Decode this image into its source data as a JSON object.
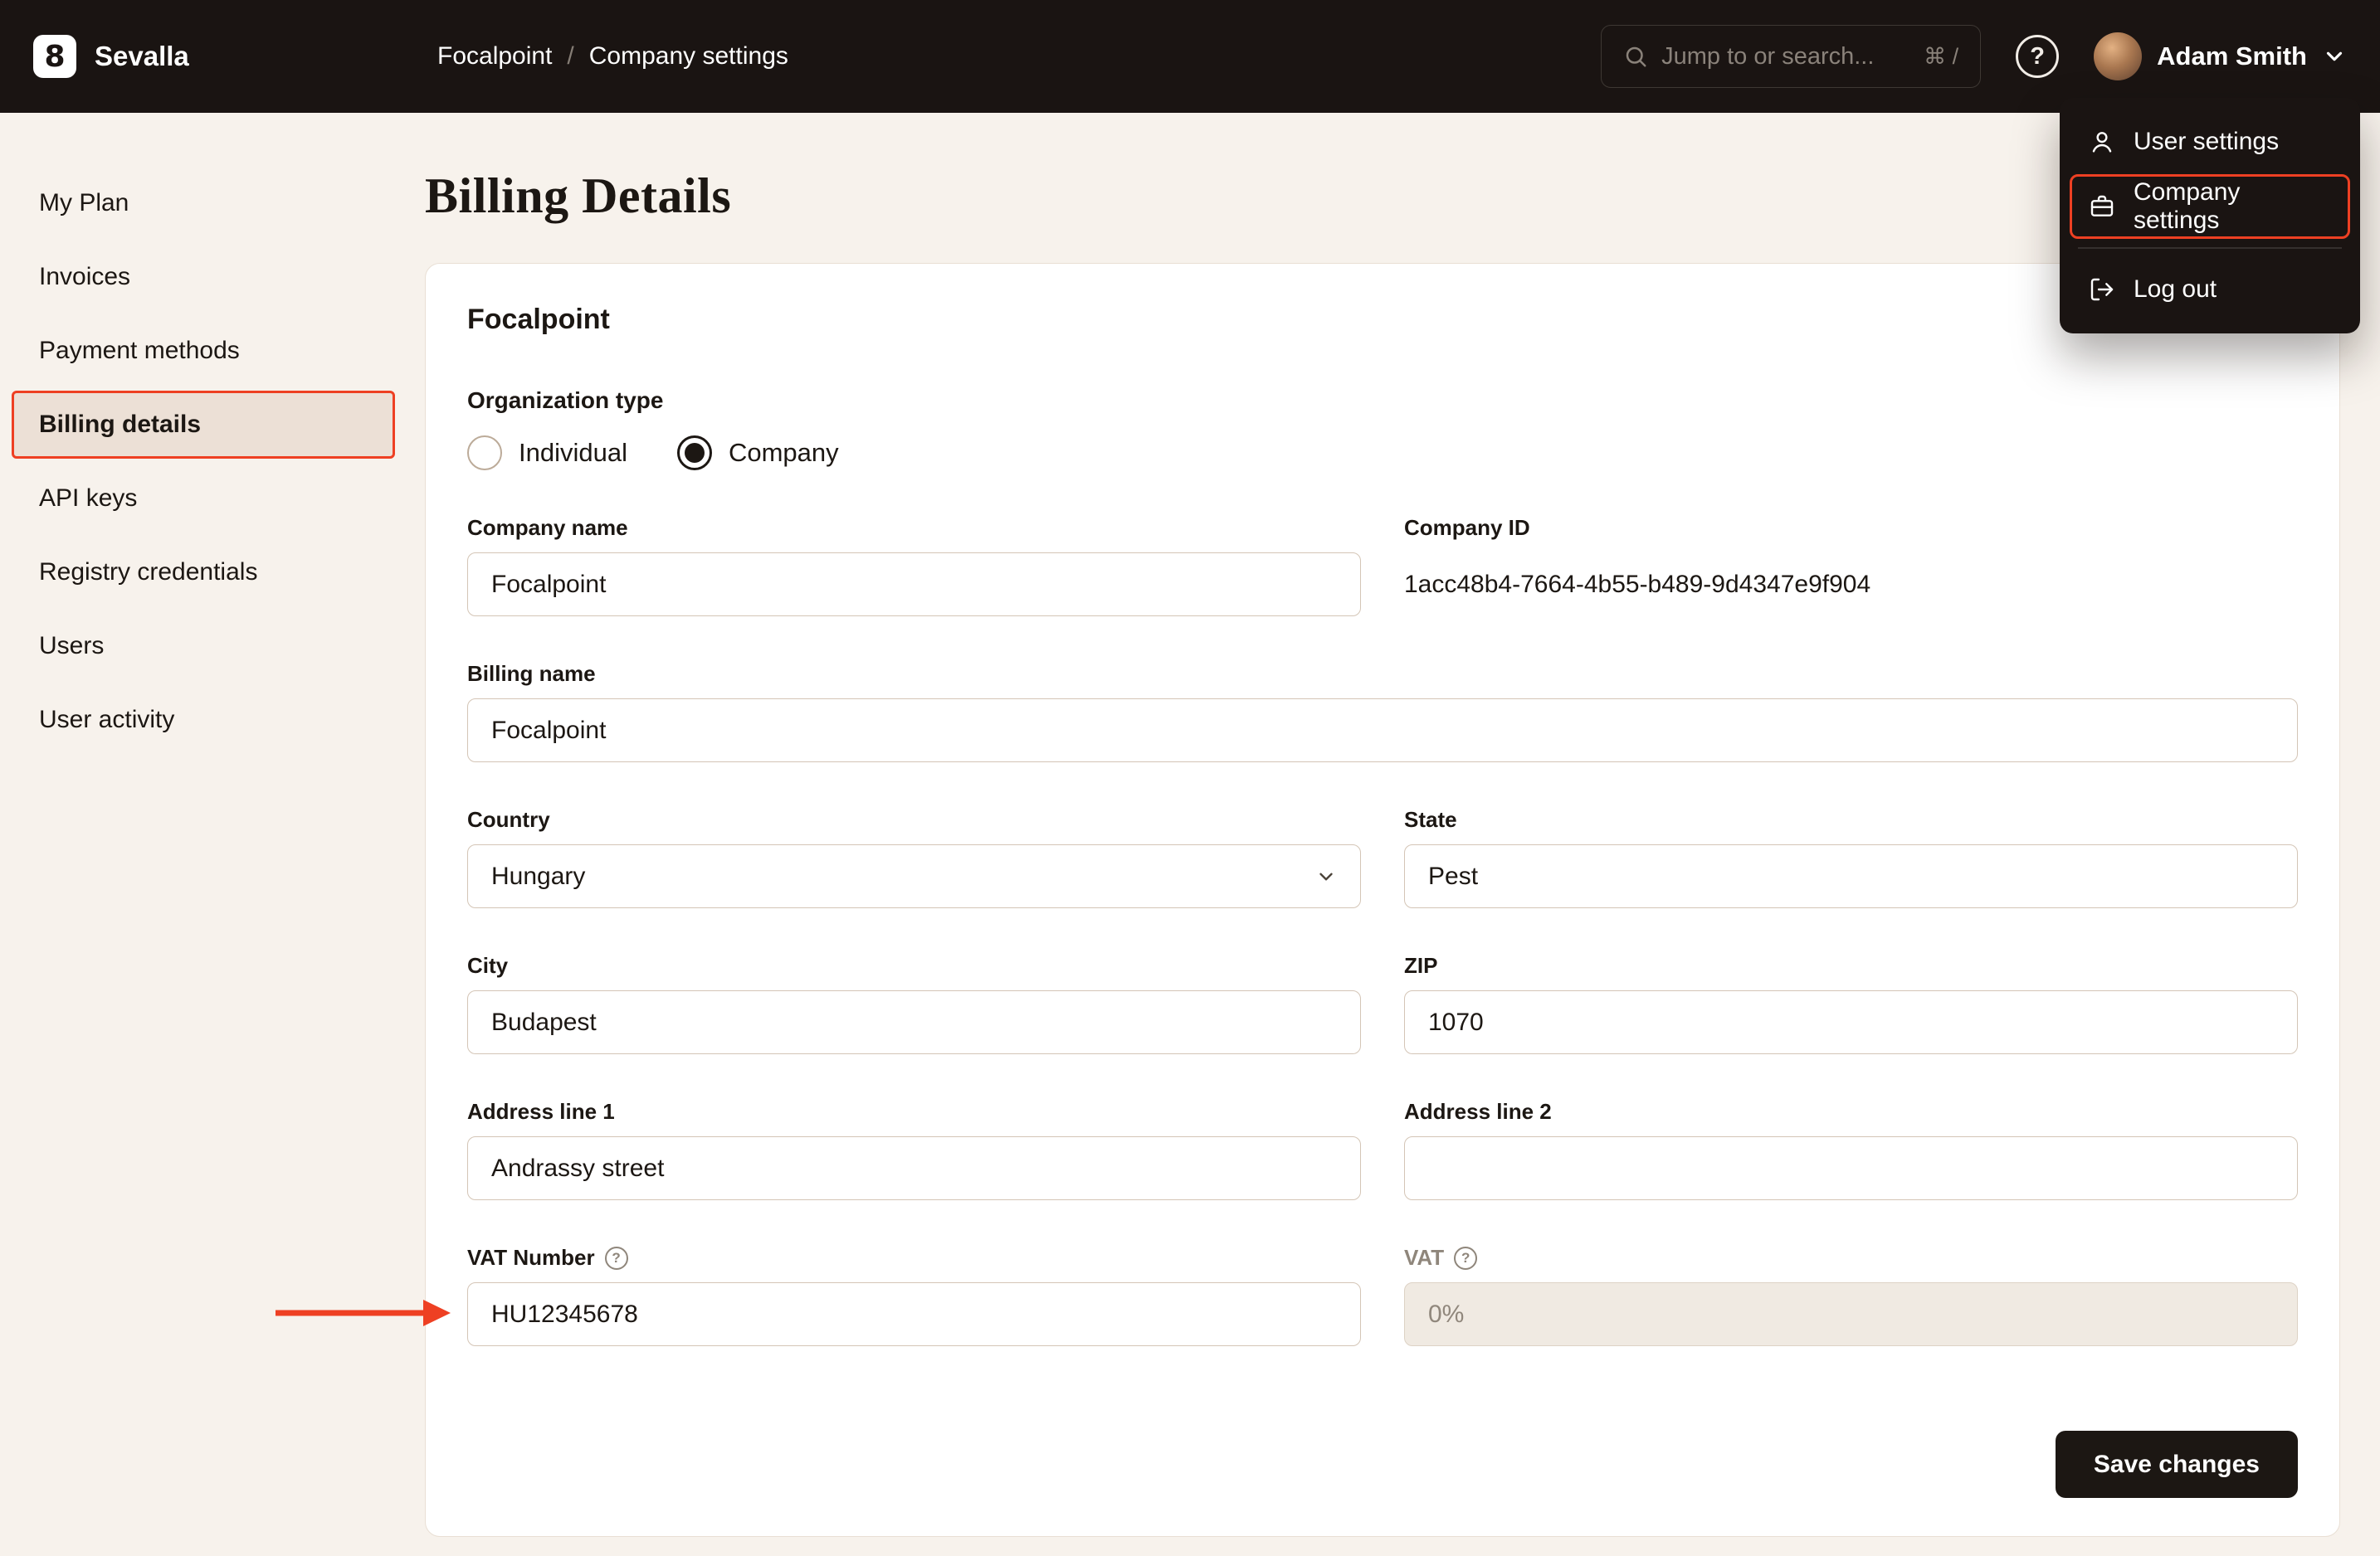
{
  "colors": {
    "accent_red": "#ee4023",
    "topbar_bg": "#1a1412",
    "page_bg": "#f7f2ec",
    "button_dark": "#1c1713",
    "sidebar_active_bg": "#ece0d6"
  },
  "icons": {
    "logo_glyph": "8",
    "help_glyph": "?"
  },
  "topbar": {
    "brand": "Sevalla",
    "breadcrumb": {
      "project": "Focalpoint",
      "separator": "/",
      "page": "Company settings"
    },
    "search": {
      "placeholder": "Jump to or search...",
      "shortcut": "⌘ /"
    },
    "user": {
      "name": "Adam Smith"
    }
  },
  "user_menu": {
    "items": [
      {
        "label": "User settings",
        "icon": "user-icon",
        "highlighted": false
      },
      {
        "label": "Company settings",
        "icon": "briefcase-icon",
        "highlighted": true
      },
      {
        "label": "Log out",
        "icon": "logout-icon",
        "highlighted": false
      }
    ]
  },
  "sidebar": {
    "items": [
      {
        "label": "My Plan",
        "active": false
      },
      {
        "label": "Invoices",
        "active": false
      },
      {
        "label": "Payment methods",
        "active": false
      },
      {
        "label": "Billing details",
        "active": true
      },
      {
        "label": "API keys",
        "active": false
      },
      {
        "label": "Registry credentials",
        "active": false
      },
      {
        "label": "Users",
        "active": false
      },
      {
        "label": "User activity",
        "active": false
      }
    ]
  },
  "page": {
    "title": "Billing Details",
    "card": {
      "company_heading": "Focalpoint",
      "organization_type": {
        "label": "Organization type",
        "options": [
          {
            "label": "Individual",
            "selected": false
          },
          {
            "label": "Company",
            "selected": true
          }
        ]
      },
      "company_name": {
        "label": "Company name",
        "value": "Focalpoint"
      },
      "company_id": {
        "label": "Company ID",
        "value": "1acc48b4-7664-4b55-b489-9d4347e9f904"
      },
      "billing_name": {
        "label": "Billing name",
        "value": "Focalpoint"
      },
      "country": {
        "label": "Country",
        "value": "Hungary"
      },
      "state": {
        "label": "State",
        "value": "Pest"
      },
      "city": {
        "label": "City",
        "value": "Budapest"
      },
      "zip": {
        "label": "ZIP",
        "value": "1070"
      },
      "address_line_1": {
        "label": "Address line 1",
        "value": "Andrassy street"
      },
      "address_line_2": {
        "label": "Address line 2",
        "value": ""
      },
      "vat_number": {
        "label": "VAT Number",
        "value": "HU12345678"
      },
      "vat": {
        "label": "VAT",
        "value": "0%"
      },
      "save_label": "Save changes"
    }
  }
}
